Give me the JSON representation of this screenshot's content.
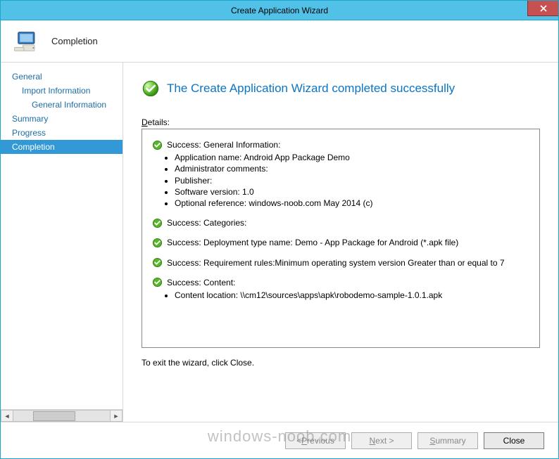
{
  "window": {
    "title": "Create Application Wizard"
  },
  "header": {
    "page_title": "Completion"
  },
  "sidebar": {
    "items": [
      {
        "label": "General",
        "indent": 0,
        "selected": false
      },
      {
        "label": "Import Information",
        "indent": 1,
        "selected": false
      },
      {
        "label": "General Information",
        "indent": 2,
        "selected": false
      },
      {
        "label": "Summary",
        "indent": 0,
        "selected": false
      },
      {
        "label": "Progress",
        "indent": 0,
        "selected": false
      },
      {
        "label": "Completion",
        "indent": 0,
        "selected": true
      }
    ]
  },
  "content": {
    "success_message": "The Create Application Wizard completed successfully",
    "details_label_pre": "D",
    "details_label_post": "etails:",
    "sections": [
      {
        "head": "Success: General Information:",
        "bullets": [
          "Application name: Android App Package Demo",
          "Administrator comments:",
          "Publisher:",
          "Software version: 1.0",
          "Optional reference: windows-noob.com May 2014 (c)"
        ]
      },
      {
        "head": "Success: Categories:",
        "bullets": []
      },
      {
        "head": "Success: Deployment type name: Demo - App Package for Android (*.apk file)",
        "bullets": []
      },
      {
        "head": "Success: Requirement rules:Minimum operating system version Greater than or equal to 7",
        "bullets": []
      },
      {
        "head": "Success: Content:",
        "bullets": [
          "Content location: \\\\cm12\\sources\\apps\\apk\\robodemo-sample-1.0.1.apk"
        ]
      }
    ],
    "exit_message": "To exit the wizard, click Close."
  },
  "footer": {
    "previous": "< Previous",
    "next": "Next >",
    "summary": "Summary",
    "close": "Close"
  },
  "watermark": "windows-noob.com"
}
